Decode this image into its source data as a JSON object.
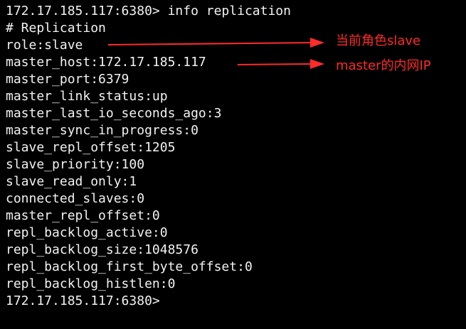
{
  "terminal": {
    "lines": [
      "172.17.185.117:6380> info replication",
      "# Replication",
      "role:slave",
      "master_host:172.17.185.117",
      "master_port:6379",
      "master_link_status:up",
      "master_last_io_seconds_ago:3",
      "master_sync_in_progress:0",
      "slave_repl_offset:1205",
      "slave_priority:100",
      "slave_read_only:1",
      "connected_slaves:0",
      "master_repl_offset:0",
      "repl_backlog_active:0",
      "repl_backlog_size:1048576",
      "repl_backlog_first_byte_offset:0",
      "repl_backlog_histlen:0",
      "172.17.185.117:6380>"
    ]
  },
  "annotations": [
    {
      "text": "当前角色slave"
    },
    {
      "text": "master的内网IP"
    }
  ],
  "colors": {
    "background": "#000000",
    "text": "#f2f2f2",
    "annotation": "#ff2a2a"
  }
}
